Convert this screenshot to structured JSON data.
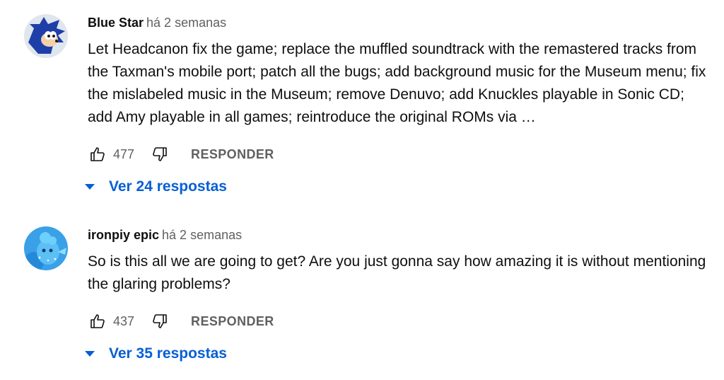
{
  "comments": [
    {
      "author": "Blue Star",
      "time": "há 2 semanas",
      "text": "Let Headcanon fix the game; replace the muffled soundtrack with the remastered tracks from the Taxman's mobile port; patch all the bugs; add background music for the Museum menu; fix the mislabeled music in the Museum; remove Denuvo; add Knuckles playable in Sonic CD; add Amy playable in all games; reintroduce the original ROMs via …",
      "likes": "477",
      "reply_label": "RESPONDER",
      "replies_label": "Ver 24 respostas",
      "avatar_icon": "sonic-avatar"
    },
    {
      "author": "ironpiy epic",
      "time": "há 2 semanas",
      "text": "So is this all we are going to get? Are you just gonna say how amazing it is without mentioning the glaring problems?",
      "likes": "437",
      "reply_label": "RESPONDER",
      "replies_label": "Ver 35 respostas",
      "avatar_icon": "blue-creature-avatar"
    }
  ],
  "colors": {
    "link": "#065fd4",
    "secondary": "#606060",
    "primary": "#0f0f0f"
  }
}
